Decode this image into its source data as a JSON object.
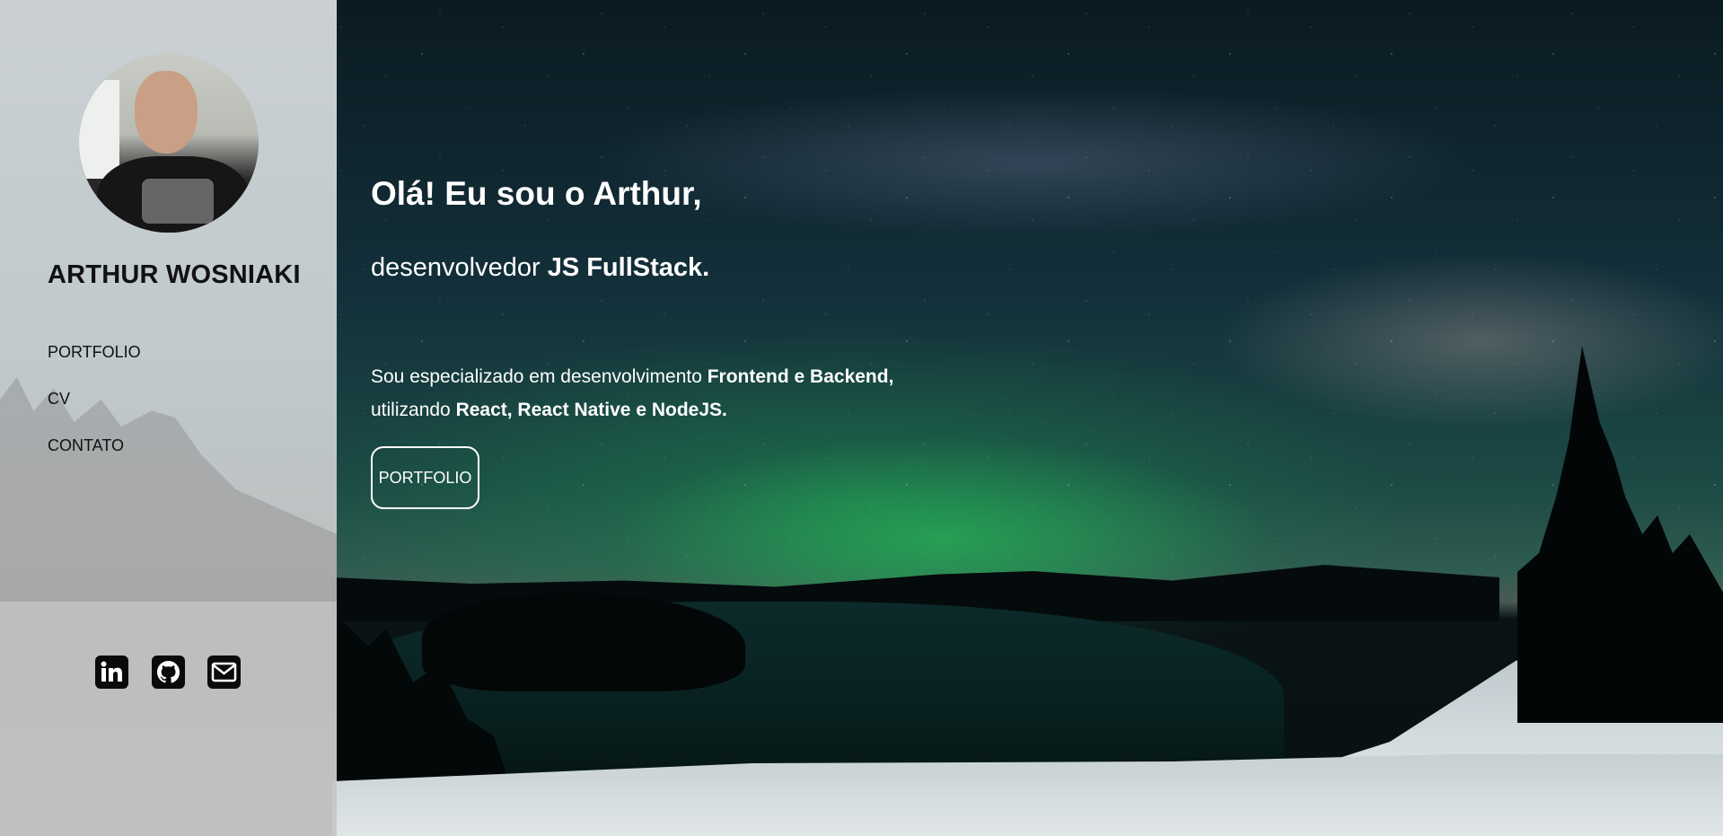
{
  "sidebar": {
    "name": "ARTHUR WOSNIAKI",
    "avatar_icon": "profile-photo",
    "nav": [
      {
        "label": "PORTFOLIO"
      },
      {
        "label": "CV"
      },
      {
        "label": "CONTATO"
      }
    ],
    "social": [
      {
        "icon": "linkedin-icon"
      },
      {
        "icon": "github-icon"
      },
      {
        "icon": "email-icon"
      }
    ]
  },
  "hero": {
    "greeting": "Olá! Eu sou o Arthur,",
    "subtitle_prefix": "desenvolvedor ",
    "subtitle_strong": "JS FullStack.",
    "desc_line1_prefix": "Sou especializado em desenvolvimento ",
    "desc_line1_strong": "Frontend e Backend,",
    "desc_line2_prefix": "utilizando ",
    "desc_line2_strong": "React, React Native e NodeJS.",
    "cta_label": "PORTFOLIO"
  },
  "colors": {
    "sidebar_bg": "#d5d9da",
    "text_dark": "#111111",
    "text_light": "#ffffff",
    "aurora": "#28c85a"
  }
}
